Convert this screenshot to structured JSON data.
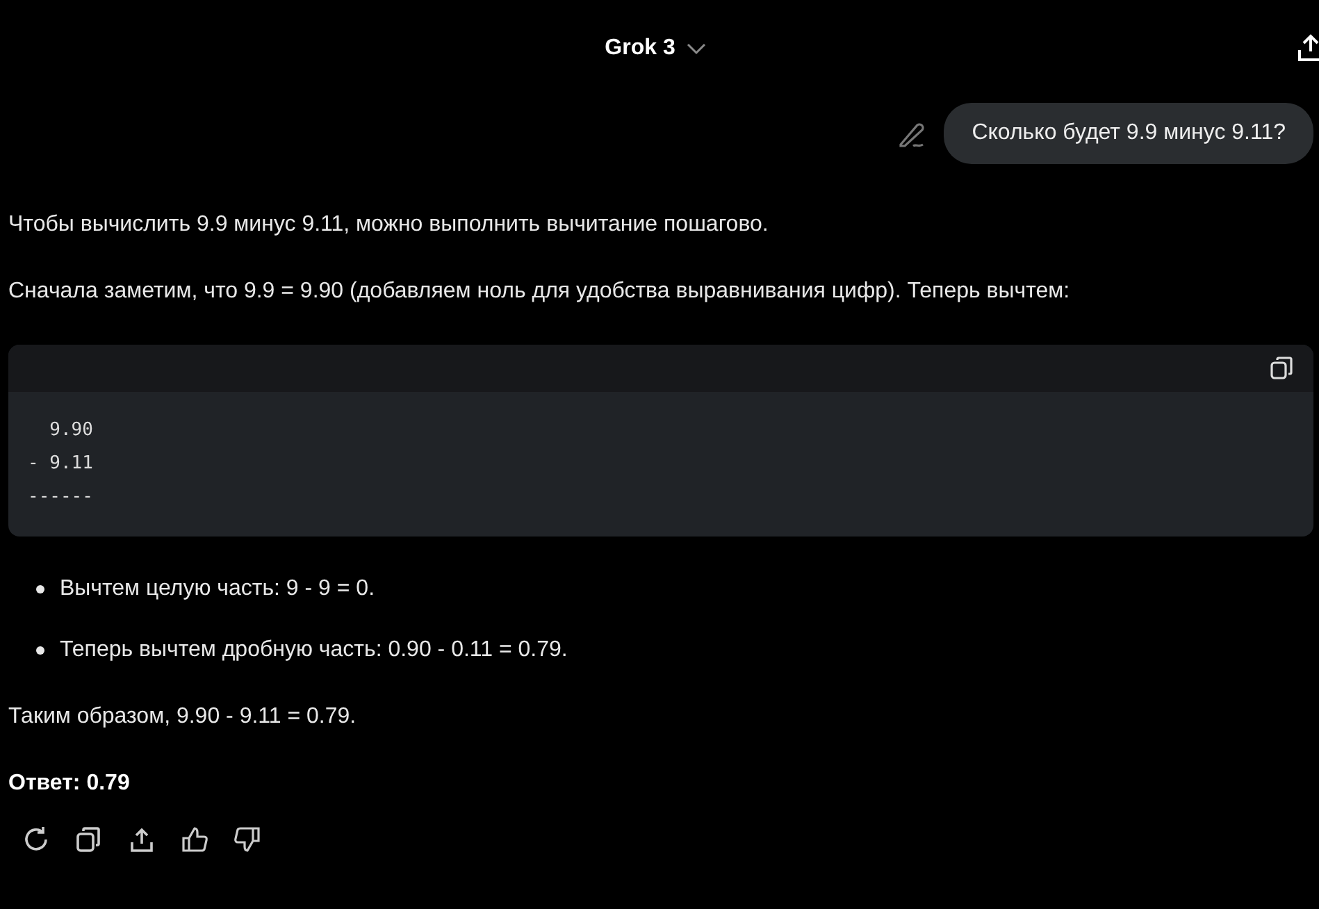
{
  "header": {
    "title": "Grok 3"
  },
  "user_message": {
    "text": "Сколько будет 9.9 минус 9.11?"
  },
  "answer": {
    "blocks": [
      {
        "kind": "paragraph",
        "text": "Чтобы вычислить 9.9 минус 9.11, можно выполнить вычитание пошагово."
      },
      {
        "kind": "paragraph",
        "text": "Сначала заметим, что 9.9 = 9.90 (добавляем ноль для удобства выравнивания цифр). Теперь вычтем:"
      },
      {
        "kind": "code",
        "lines": [
          "  9.90",
          "- 9.11",
          "------"
        ]
      },
      {
        "kind": "list",
        "items": [
          "Вычтем целую часть: 9 - 9 = 0.",
          "Теперь вычтем дробную часть: 0.90 - 0.11 = 0.79."
        ]
      },
      {
        "kind": "paragraph",
        "text": "Таким образом, 9.90 - 9.11 = 0.79."
      },
      {
        "kind": "paragraph",
        "text": "**Ответ: 0.79**"
      }
    ]
  }
}
